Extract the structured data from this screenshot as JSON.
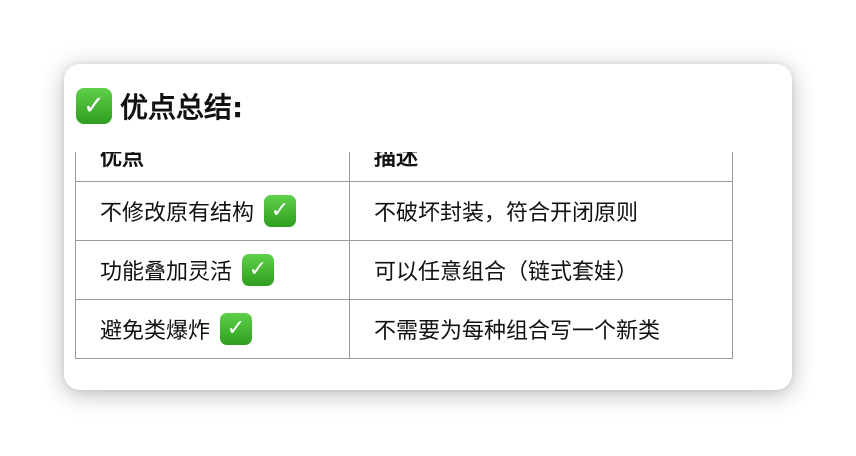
{
  "heading": {
    "icon": "check-mark-button-icon",
    "text": "优点总结:"
  },
  "table": {
    "headers": [
      "优点",
      "描述"
    ],
    "rows": [
      {
        "advantage": "不修改原有结构",
        "icon": "check-mark-button-icon",
        "description": "不破坏封装，符合开闭原则"
      },
      {
        "advantage": "功能叠加灵活",
        "icon": "check-mark-button-icon",
        "description": "可以任意组合（链式套娃）"
      },
      {
        "advantage": "避免类爆炸",
        "icon": "check-mark-button-icon",
        "description": "不需要为每种组合写一个新类"
      }
    ]
  },
  "colors": {
    "check_green": "#3cb52b",
    "border": "#9a9a9a",
    "text": "#111111"
  }
}
